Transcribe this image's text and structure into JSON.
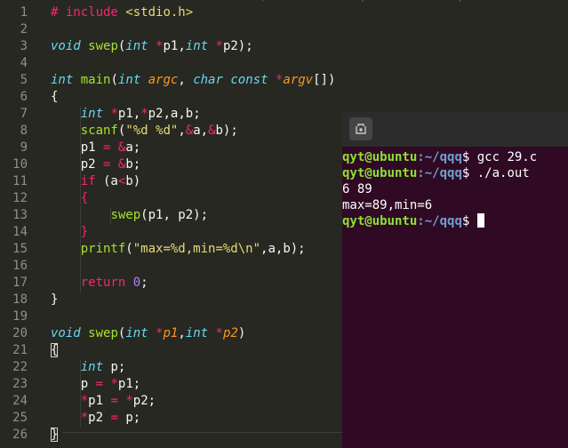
{
  "editor": {
    "cut_line": "  #                           /             ,             ,",
    "line_numbers": [
      "1",
      "2",
      "3",
      "4",
      "5",
      "6",
      "7",
      "8",
      "9",
      "10",
      "11",
      "12",
      "13",
      "14",
      "15",
      "16",
      "17",
      "18",
      "19",
      "20",
      "21",
      "22",
      "23",
      "24",
      "25",
      "26"
    ],
    "lines": [
      [
        [
          "op",
          "# include "
        ],
        [
          "str",
          "<stdio.h>"
        ]
      ],
      [],
      [
        [
          "kw",
          "void"
        ],
        [
          "plain",
          " "
        ],
        [
          "fn",
          "swep"
        ],
        [
          "plain",
          "("
        ],
        [
          "kw",
          "int"
        ],
        [
          "plain",
          " "
        ],
        [
          "op",
          "*"
        ],
        [
          "plain",
          "p1,"
        ],
        [
          "kw",
          "int"
        ],
        [
          "plain",
          " "
        ],
        [
          "op",
          "*"
        ],
        [
          "plain",
          "p2);"
        ]
      ],
      [],
      [
        [
          "kw",
          "int"
        ],
        [
          "plain",
          " "
        ],
        [
          "fn",
          "main"
        ],
        [
          "plain",
          "("
        ],
        [
          "kw",
          "int"
        ],
        [
          "plain",
          " "
        ],
        [
          "par",
          "argc"
        ],
        [
          "plain",
          ", "
        ],
        [
          "kw",
          "char"
        ],
        [
          "plain",
          " "
        ],
        [
          "kw",
          "const"
        ],
        [
          "plain",
          " "
        ],
        [
          "op",
          "*"
        ],
        [
          "par",
          "argv"
        ],
        [
          "plain",
          "[])"
        ]
      ],
      [
        [
          "brace",
          "{"
        ]
      ],
      [
        [
          "plain",
          "    "
        ],
        [
          "kw",
          "int"
        ],
        [
          "plain",
          " "
        ],
        [
          "op",
          "*"
        ],
        [
          "plain",
          "p1,"
        ],
        [
          "op",
          "*"
        ],
        [
          "plain",
          "p2,a,b;"
        ]
      ],
      [
        [
          "plain",
          "    "
        ],
        [
          "fn",
          "scanf"
        ],
        [
          "plain",
          "("
        ],
        [
          "str",
          "\"%d %d\""
        ],
        [
          "plain",
          ","
        ],
        [
          "op",
          "&"
        ],
        [
          "plain",
          "a,"
        ],
        [
          "op",
          "&"
        ],
        [
          "plain",
          "b);"
        ]
      ],
      [
        [
          "plain",
          "    p1 "
        ],
        [
          "op",
          "="
        ],
        [
          "plain",
          " "
        ],
        [
          "op",
          "&"
        ],
        [
          "plain",
          "a;"
        ]
      ],
      [
        [
          "plain",
          "    p2 "
        ],
        [
          "op",
          "="
        ],
        [
          "plain",
          " "
        ],
        [
          "op",
          "&"
        ],
        [
          "plain",
          "b;"
        ]
      ],
      [
        [
          "plain",
          "    "
        ],
        [
          "op",
          "if"
        ],
        [
          "plain",
          " (a"
        ],
        [
          "op",
          "<"
        ],
        [
          "plain",
          "b)"
        ]
      ],
      [
        [
          "plain",
          "    "
        ],
        [
          "op",
          "{"
        ]
      ],
      [
        [
          "plain",
          "        "
        ],
        [
          "fn",
          "swep"
        ],
        [
          "plain",
          "(p1, p2);"
        ]
      ],
      [
        [
          "plain",
          "    "
        ],
        [
          "op",
          "}"
        ]
      ],
      [
        [
          "plain",
          "    "
        ],
        [
          "fn",
          "printf"
        ],
        [
          "plain",
          "("
        ],
        [
          "str",
          "\"max=%d,min=%d\\n\""
        ],
        [
          "plain",
          ",a,b);"
        ]
      ],
      [],
      [
        [
          "plain",
          "    "
        ],
        [
          "op",
          "return"
        ],
        [
          "plain",
          " "
        ],
        [
          "num",
          "0"
        ],
        [
          "plain",
          ";"
        ]
      ],
      [
        [
          "brace",
          "}"
        ]
      ],
      [],
      [
        [
          "kw",
          "void"
        ],
        [
          "plain",
          " "
        ],
        [
          "fn",
          "swep"
        ],
        [
          "plain",
          "("
        ],
        [
          "kw",
          "int"
        ],
        [
          "plain",
          " "
        ],
        [
          "op",
          "*"
        ],
        [
          "par",
          "p1"
        ],
        [
          "plain",
          ","
        ],
        [
          "kw",
          "int"
        ],
        [
          "plain",
          " "
        ],
        [
          "op",
          "*"
        ],
        [
          "par",
          "p2"
        ],
        [
          "plain",
          ")"
        ]
      ],
      [
        [
          "brace",
          "{"
        ]
      ],
      [
        [
          "plain",
          "    "
        ],
        [
          "kw",
          "int"
        ],
        [
          "plain",
          " p;"
        ]
      ],
      [
        [
          "plain",
          "    p "
        ],
        [
          "op",
          "="
        ],
        [
          "plain",
          " "
        ],
        [
          "op",
          "*"
        ],
        [
          "plain",
          "p1;"
        ]
      ],
      [
        [
          "plain",
          "    "
        ],
        [
          "op",
          "*"
        ],
        [
          "plain",
          "p1 "
        ],
        [
          "op",
          "="
        ],
        [
          "plain",
          " "
        ],
        [
          "op",
          "*"
        ],
        [
          "plain",
          "p2;"
        ]
      ],
      [
        [
          "plain",
          "    "
        ],
        [
          "op",
          "*"
        ],
        [
          "plain",
          "p2 "
        ],
        [
          "op",
          "="
        ],
        [
          "plain",
          " p;"
        ]
      ],
      [
        [
          "brace",
          "}"
        ]
      ]
    ],
    "matched_brace_lines": [
      21,
      26
    ]
  },
  "terminal": {
    "new_tab_icon": "new-tab-icon",
    "lines": [
      {
        "user": "qyt@ubuntu",
        "path": ":~/qqq",
        "cmd": "$ gcc 29.c"
      },
      {
        "user": "qyt@ubuntu",
        "path": ":~/qqq",
        "cmd": "$ ./a.out"
      },
      {
        "text": "6 89"
      },
      {
        "text": "max=89,min=6"
      },
      {
        "user": "qyt@ubuntu",
        "path": ":~/qqq",
        "cmd": "$ ",
        "cursor": true
      }
    ]
  },
  "colors": {
    "editor_bg": "#272822",
    "terminal_bg": "#300a24",
    "prompt_user": "#8ae234",
    "prompt_path": "#729fcf"
  }
}
